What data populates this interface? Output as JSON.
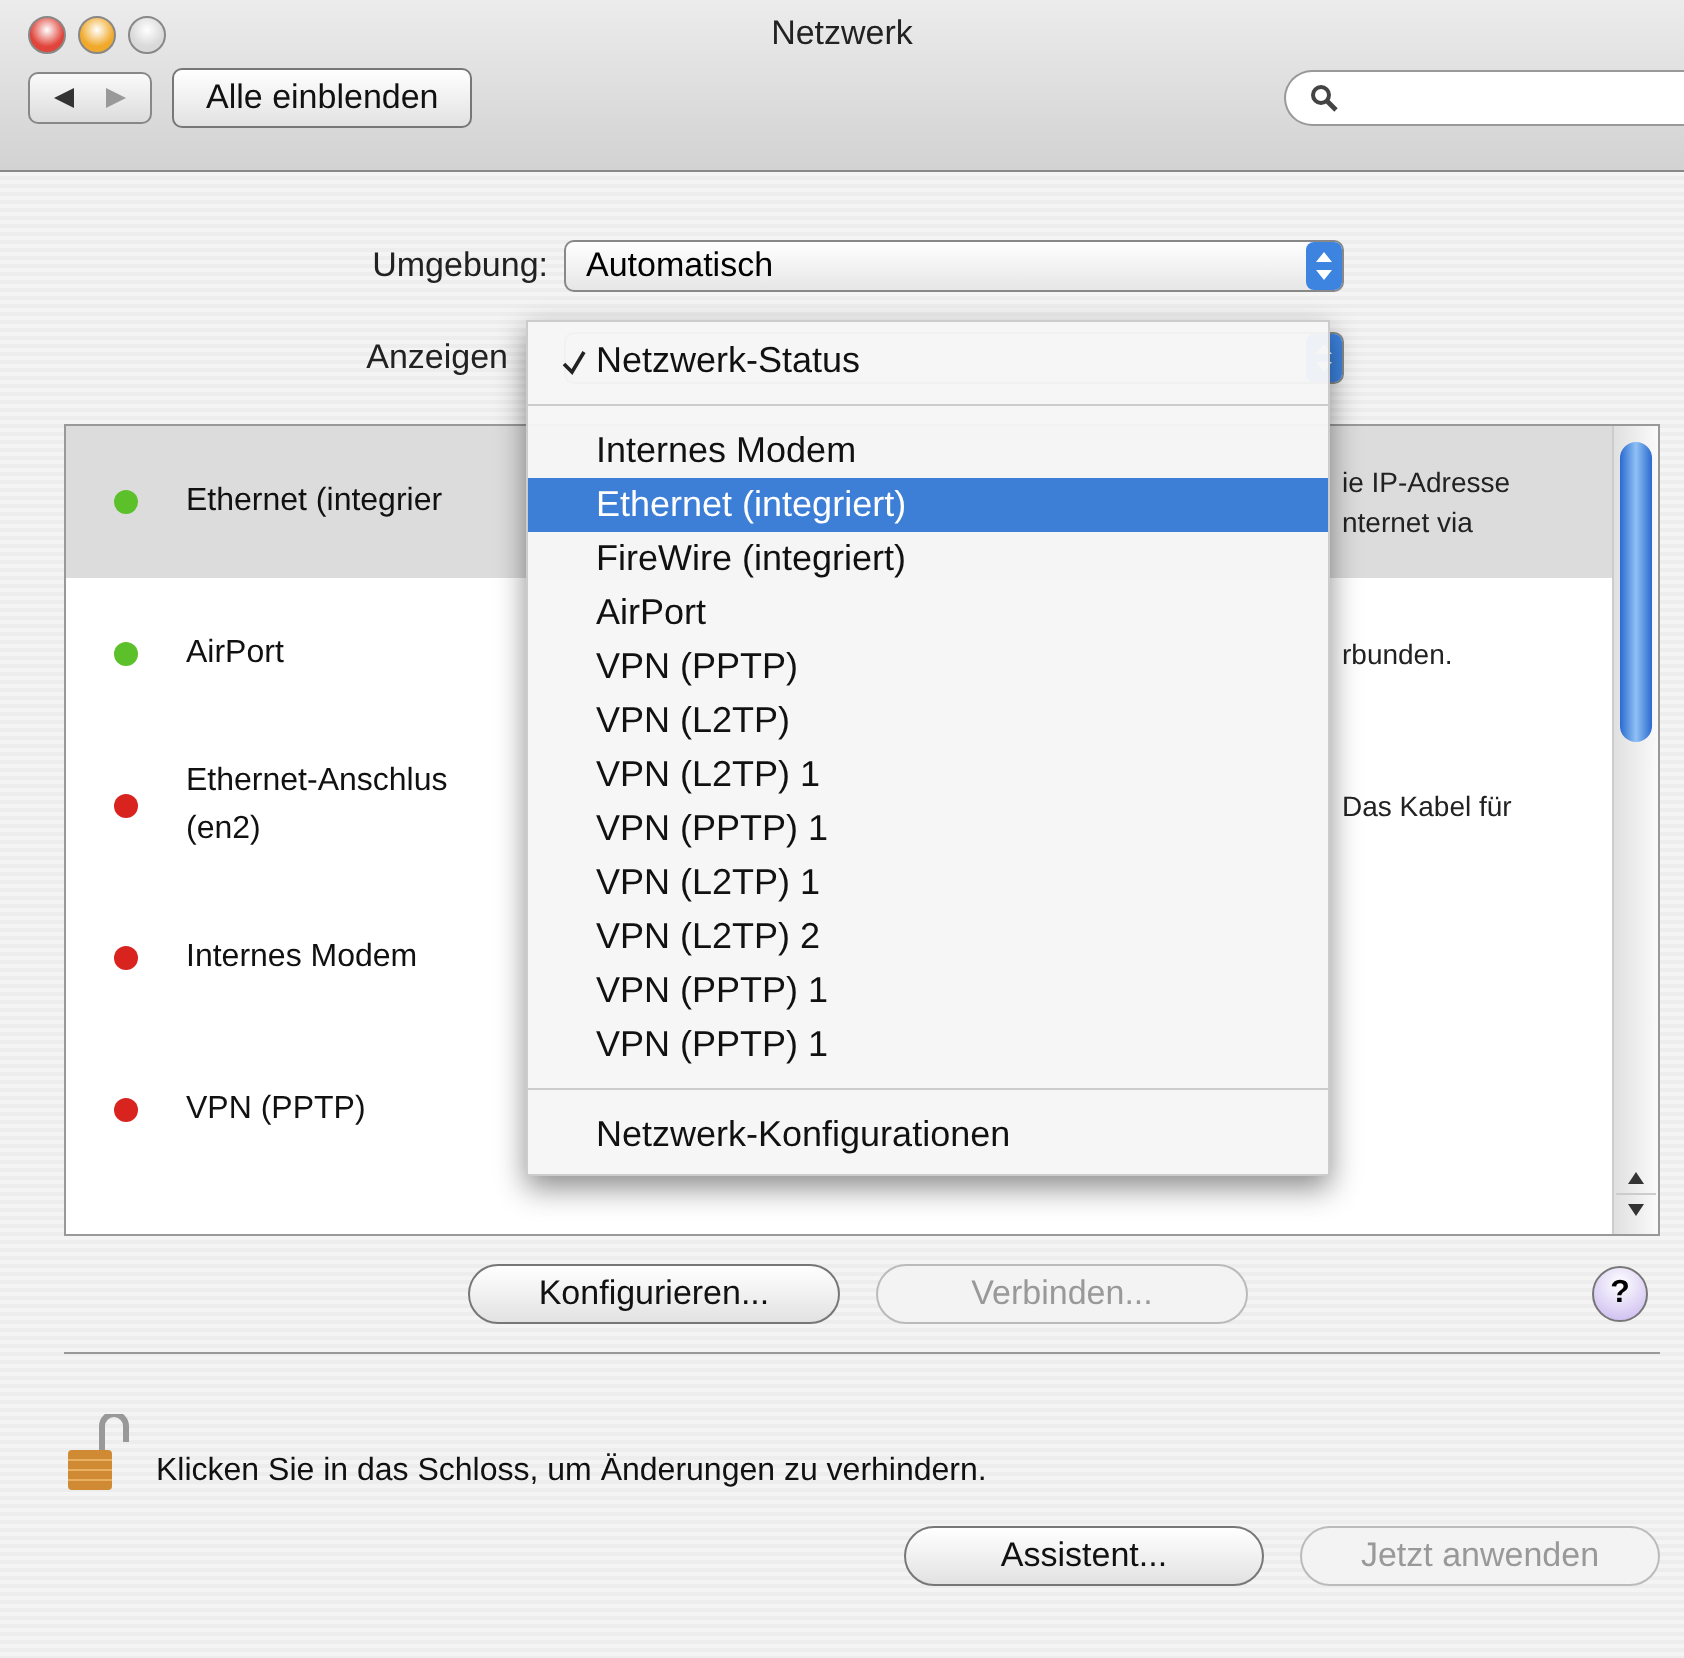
{
  "window": {
    "title": "Netzwerk"
  },
  "toolbar": {
    "show_all_button": "Alle einblenden"
  },
  "location": {
    "label": "Umgebung:",
    "value": "Automatisch"
  },
  "show": {
    "label": "Anzeigen"
  },
  "services": [
    {
      "name": "Ethernet (integrier",
      "color": "#5cc02a",
      "selected": true,
      "description": [
        "ie IP-Adresse",
        "nternet via"
      ]
    },
    {
      "name": "AirPort",
      "color": "#5cc02a",
      "selected": false,
      "description": [
        "rbunden."
      ]
    },
    {
      "name": "Ethernet-Anschlus\n(en2)",
      "color": "#d8231e",
      "selected": false,
      "description": [
        "Das Kabel für"
      ]
    },
    {
      "name": "Internes Modem",
      "color": "#d8231e",
      "selected": false
    },
    {
      "name": "VPN (PPTP)",
      "color": "#d8231e",
      "selected": false
    }
  ],
  "menu": [
    {
      "kind": "item",
      "label": "Netzwerk-Status",
      "checked": true,
      "selected": false
    },
    {
      "kind": "separator"
    },
    {
      "kind": "item",
      "label": "Internes Modem",
      "checked": false,
      "selected": false
    },
    {
      "kind": "item",
      "label": "Ethernet (integriert)",
      "checked": false,
      "selected": true
    },
    {
      "kind": "item",
      "label": "FireWire (integriert)",
      "checked": false,
      "selected": false
    },
    {
      "kind": "item",
      "label": "AirPort",
      "checked": false,
      "selected": false
    },
    {
      "kind": "item",
      "label": "VPN (PPTP)",
      "checked": false,
      "selected": false
    },
    {
      "kind": "item",
      "label": "VPN (L2TP)",
      "checked": false,
      "selected": false
    },
    {
      "kind": "item",
      "label": "VPN (L2TP) 1",
      "checked": false,
      "selected": false
    },
    {
      "kind": "item",
      "label": "VPN (PPTP) 1",
      "checked": false,
      "selected": false
    },
    {
      "kind": "item",
      "label": "VPN (L2TP) 1",
      "checked": false,
      "selected": false
    },
    {
      "kind": "item",
      "label": "VPN (L2TP) 2",
      "checked": false,
      "selected": false
    },
    {
      "kind": "item",
      "label": "VPN (PPTP) 1",
      "checked": false,
      "selected": false
    },
    {
      "kind": "item",
      "label": "VPN (PPTP) 1",
      "checked": false,
      "selected": false
    },
    {
      "kind": "separator"
    },
    {
      "kind": "item",
      "label": "Netzwerk-Konfigurationen",
      "checked": false,
      "selected": false
    }
  ],
  "actions": [
    {
      "label": "Konfigurieren...",
      "disabled": false
    },
    {
      "label": "Verbinden...",
      "disabled": true
    }
  ],
  "help_button": "?",
  "lock_message": "Klicken Sie in das Schloss, um Änderungen zu verhindern.",
  "footer_buttons": [
    {
      "label": "Assistent...",
      "disabled": false
    },
    {
      "label": "Jetzt anwenden",
      "disabled": true
    }
  ]
}
